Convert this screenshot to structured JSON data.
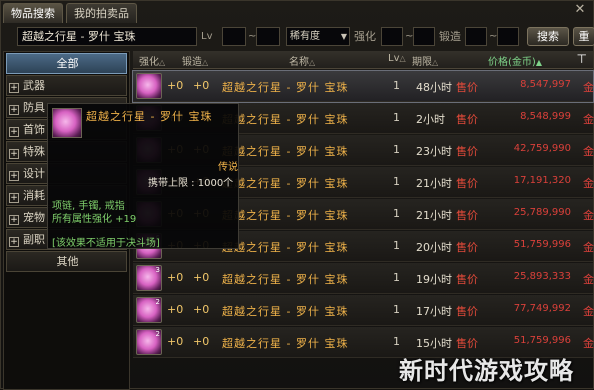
{
  "tabs": [
    "物品搜索",
    "我的拍卖品"
  ],
  "search": {
    "item_name": "超越之行星 - 罗什  宝珠",
    "lv_label": "Lv",
    "rarity_value": "稀有度",
    "enhance_label": "强化",
    "regen_label": "锻造",
    "search_button": "搜索",
    "reset_button": "重"
  },
  "categories": [
    {
      "label": "全部"
    },
    {
      "label": "武器"
    },
    {
      "label": "防具"
    },
    {
      "label": "首饰"
    },
    {
      "label": "特殊"
    },
    {
      "label": "设计"
    },
    {
      "label": "消耗"
    },
    {
      "label": "宠物"
    },
    {
      "label": "副职"
    },
    {
      "label": "其他"
    }
  ],
  "columns": {
    "enhance": "强化",
    "regen": "锻造",
    "name": "名称",
    "lv": "Lv",
    "deadline": "期限",
    "price": "价格(金币)"
  },
  "rows": [
    {
      "enh": "+0",
      "reg": "+0",
      "name": "超越之行星 - 罗什  宝珠",
      "lv": "1",
      "time": "48小时",
      "sell": "售价",
      "price": "8,547,997",
      "cur": "金币",
      "badge": ""
    },
    {
      "enh": "+0",
      "reg": "+0",
      "name": "超越之行星 - 罗什  宝珠",
      "lv": "1",
      "time": "2小时",
      "sell": "售价",
      "price": "8,548,999",
      "cur": "金币",
      "badge": ""
    },
    {
      "enh": "+0",
      "reg": "+0",
      "name": "超越之行星 - 罗什  宝珠",
      "lv": "1",
      "time": "23小时",
      "sell": "售价",
      "price": "42,759,990",
      "cur": "金币",
      "badge": ""
    },
    {
      "enh": "+0",
      "reg": "+0",
      "name": "超越之行星 - 罗什  宝珠",
      "lv": "1",
      "time": "21小时",
      "sell": "售价",
      "price": "17,191,320",
      "cur": "金币",
      "badge": ""
    },
    {
      "enh": "+0",
      "reg": "+0",
      "name": "超越之行星 - 罗什  宝珠",
      "lv": "1",
      "time": "21小时",
      "sell": "售价",
      "price": "25,789,990",
      "cur": "金币",
      "badge": ""
    },
    {
      "enh": "+0",
      "reg": "+0",
      "name": "超越之行星 - 罗什  宝珠",
      "lv": "1",
      "time": "20小时",
      "sell": "售价",
      "price": "51,759,996",
      "cur": "金币",
      "badge": "6"
    },
    {
      "enh": "+0",
      "reg": "+0",
      "name": "超越之行星 - 罗什  宝珠",
      "lv": "1",
      "time": "19小时",
      "sell": "售价",
      "price": "25,893,333",
      "cur": "金币",
      "badge": "3"
    },
    {
      "enh": "+0",
      "reg": "+0",
      "name": "超越之行星 - 罗什  宝珠",
      "lv": "1",
      "time": "17小时",
      "sell": "售价",
      "price": "77,749,992",
      "cur": "金币",
      "badge": "2"
    },
    {
      "enh": "+0",
      "reg": "+0",
      "name": "超越之行星 - 罗什  宝珠",
      "lv": "1",
      "time": "15小时",
      "sell": "售价",
      "price": "51,759,996",
      "cur": "金币",
      "badge": "2"
    }
  ],
  "tooltip": {
    "title": "超越之行星 - 罗什  宝珠",
    "legend": "传说",
    "carry_limit": "携带上限 : 1000个",
    "slots": "项链, 手镯, 戒指",
    "attr": "所有属性强化 +19",
    "note": "[该效果不适用于决斗场]"
  },
  "watermark": "新时代游戏攻略"
}
